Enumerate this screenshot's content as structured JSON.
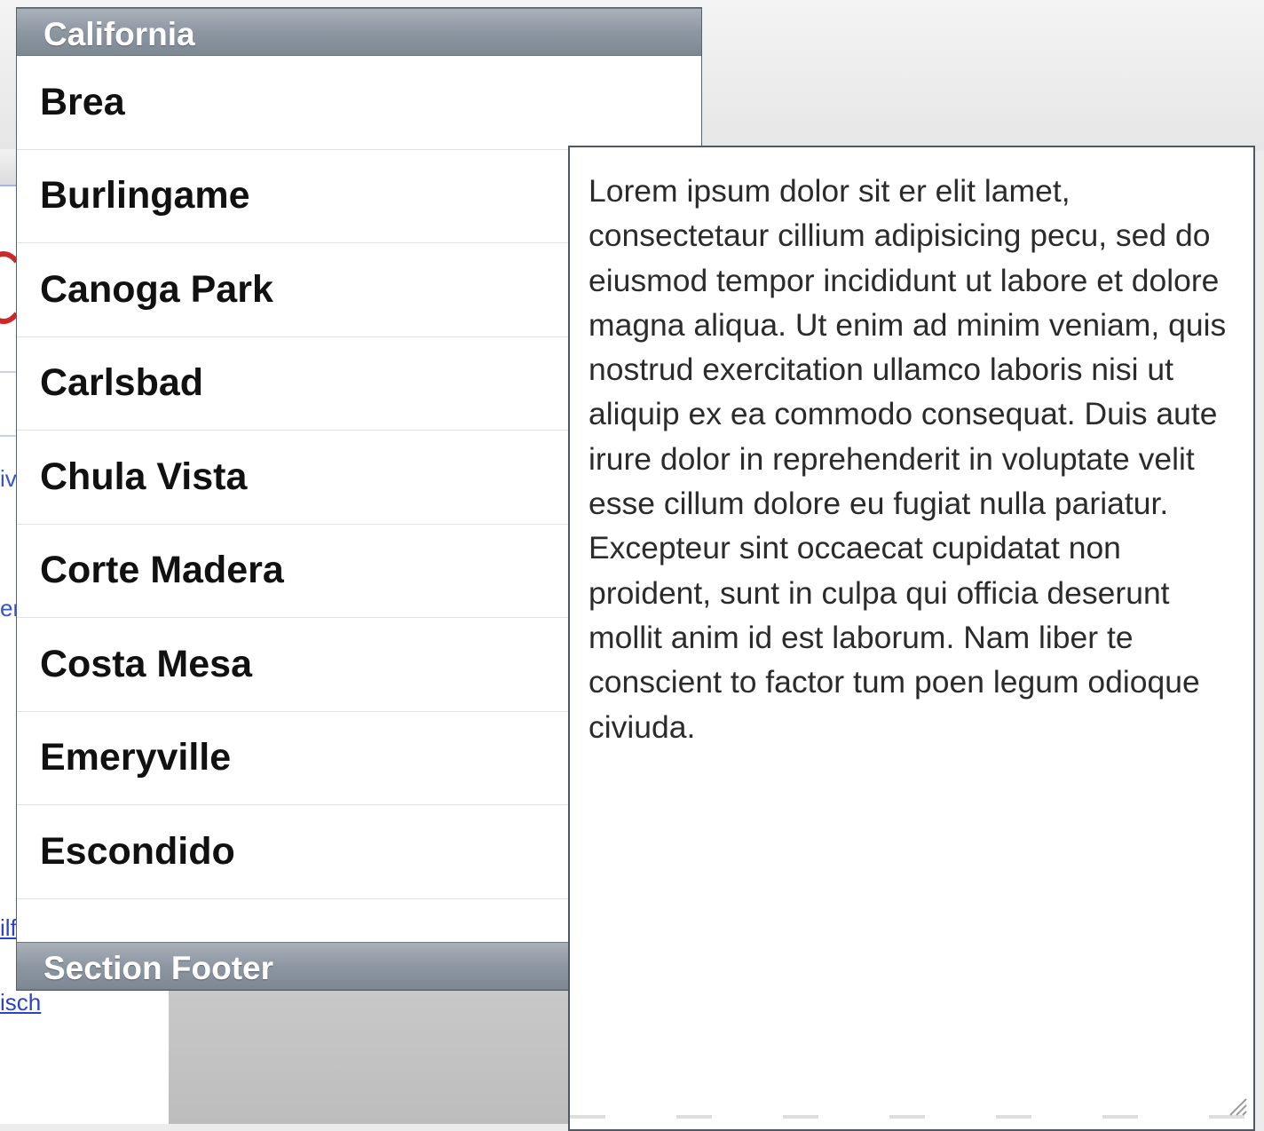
{
  "table": {
    "section_header": "California",
    "rows": [
      "Brea",
      "Burlingame",
      "Canoga Park",
      "Carlsbad",
      "Chula Vista",
      "Corte Madera",
      "Costa Mesa",
      "Emeryville",
      "Escondido"
    ],
    "section_footer": "Section Footer"
  },
  "text_view": {
    "content": "Lorem ipsum dolor sit er elit lamet, consectetaur cillium adipisicing pecu, sed do eiusmod tempor incididunt ut labore et dolore magna aliqua. Ut enim ad minim veniam, quis nostrud exercitation ullamco laboris nisi ut aliquip ex ea commodo consequat. Duis aute irure dolor in reprehenderit in voluptate velit esse cillum dolore eu fugiat nulla pariatur. Excepteur sint occaecat cupidatat non proident, sunt in culpa qui officia deserunt mollit anim id est laborum. Nam liber te conscient to factor tum poen legum odioque civiuda."
  },
  "background": {
    "fragments": [
      "iv",
      "er",
      "ilf",
      "isch"
    ]
  }
}
